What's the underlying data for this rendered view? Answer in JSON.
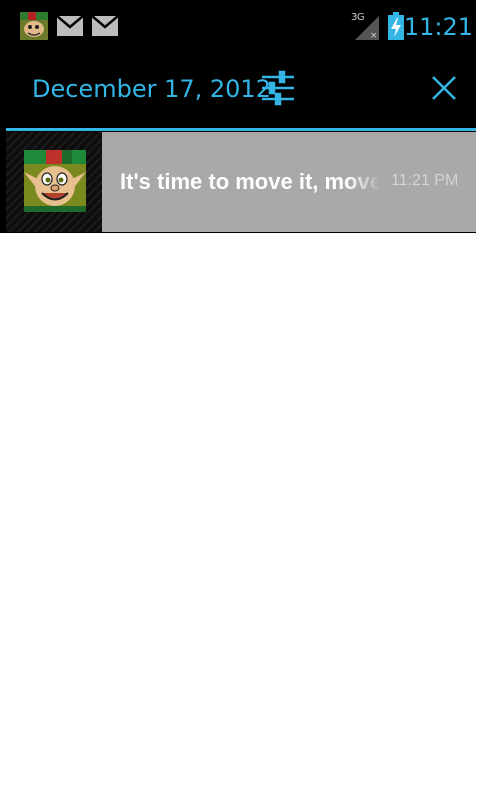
{
  "status_bar": {
    "icons": [
      "app-notification-icon",
      "mail-icon",
      "mail-icon",
      "signal-3g-icon",
      "battery-charging-icon"
    ],
    "network_label": "3G",
    "time": "11:21",
    "accent_color": "#33b5e5"
  },
  "header": {
    "date": "December 17, 2012",
    "settings_icon": "quick-settings-sliders-icon",
    "close_icon": "clear-all-x-icon"
  },
  "notifications": [
    {
      "icon": "elf-face-icon",
      "title": "It's time to move it, move it",
      "time": "11:21 PM"
    }
  ],
  "colors": {
    "shade_background": "#000000",
    "notification_background": "#a9a9ab",
    "accent": "#33b5e5"
  }
}
